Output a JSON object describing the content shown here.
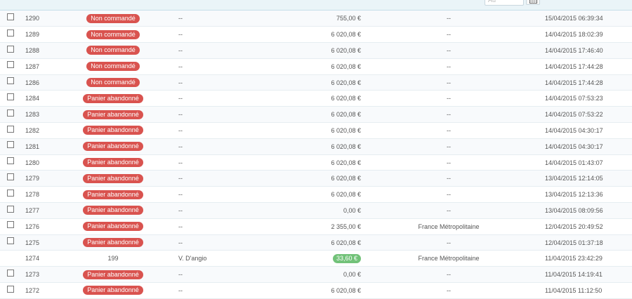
{
  "filter": {
    "to_placeholder": "Au"
  },
  "rows": [
    {
      "id": "1290",
      "status": "Non commandé",
      "status_type": "badge",
      "customer": "--",
      "total": "755,00 €",
      "total_type": "plain",
      "carrier": "--",
      "date": "15/04/2015 06:39:34",
      "checkbox": true
    },
    {
      "id": "1289",
      "status": "Non commandé",
      "status_type": "badge",
      "customer": "--",
      "total": "6 020,08 €",
      "total_type": "plain",
      "carrier": "--",
      "date": "14/04/2015 18:02:39",
      "checkbox": true
    },
    {
      "id": "1288",
      "status": "Non commandé",
      "status_type": "badge",
      "customer": "--",
      "total": "6 020,08 €",
      "total_type": "plain",
      "carrier": "--",
      "date": "14/04/2015 17:46:40",
      "checkbox": true
    },
    {
      "id": "1287",
      "status": "Non commandé",
      "status_type": "badge",
      "customer": "--",
      "total": "6 020,08 €",
      "total_type": "plain",
      "carrier": "--",
      "date": "14/04/2015 17:44:28",
      "checkbox": true
    },
    {
      "id": "1286",
      "status": "Non commandé",
      "status_type": "badge",
      "customer": "--",
      "total": "6 020,08 €",
      "total_type": "plain",
      "carrier": "--",
      "date": "14/04/2015 17:44:28",
      "checkbox": true
    },
    {
      "id": "1284",
      "status": "Panier abandonné",
      "status_type": "badge",
      "customer": "--",
      "total": "6 020,08 €",
      "total_type": "plain",
      "carrier": "--",
      "date": "14/04/2015 07:53:23",
      "checkbox": true
    },
    {
      "id": "1283",
      "status": "Panier abandonné",
      "status_type": "badge",
      "customer": "--",
      "total": "6 020,08 €",
      "total_type": "plain",
      "carrier": "--",
      "date": "14/04/2015 07:53:22",
      "checkbox": true
    },
    {
      "id": "1282",
      "status": "Panier abandonné",
      "status_type": "badge",
      "customer": "--",
      "total": "6 020,08 €",
      "total_type": "plain",
      "carrier": "--",
      "date": "14/04/2015 04:30:17",
      "checkbox": true
    },
    {
      "id": "1281",
      "status": "Panier abandonné",
      "status_type": "badge",
      "customer": "--",
      "total": "6 020,08 €",
      "total_type": "plain",
      "carrier": "--",
      "date": "14/04/2015 04:30:17",
      "checkbox": true
    },
    {
      "id": "1280",
      "status": "Panier abandonné",
      "status_type": "badge",
      "customer": "--",
      "total": "6 020,08 €",
      "total_type": "plain",
      "carrier": "--",
      "date": "14/04/2015 01:43:07",
      "checkbox": true
    },
    {
      "id": "1279",
      "status": "Panier abandonné",
      "status_type": "badge",
      "customer": "--",
      "total": "6 020,08 €",
      "total_type": "plain",
      "carrier": "--",
      "date": "13/04/2015 12:14:05",
      "checkbox": true
    },
    {
      "id": "1278",
      "status": "Panier abandonné",
      "status_type": "badge",
      "customer": "--",
      "total": "6 020,08 €",
      "total_type": "plain",
      "carrier": "--",
      "date": "13/04/2015 12:13:36",
      "checkbox": true
    },
    {
      "id": "1277",
      "status": "Panier abandonné",
      "status_type": "badge",
      "customer": "--",
      "total": "0,00 €",
      "total_type": "plain",
      "carrier": "--",
      "date": "13/04/2015 08:09:56",
      "checkbox": true
    },
    {
      "id": "1276",
      "status": "Panier abandonné",
      "status_type": "badge",
      "customer": "--",
      "total": "2 355,00 €",
      "total_type": "plain",
      "carrier": "France Métropolitaine",
      "date": "12/04/2015 20:49:52",
      "checkbox": true
    },
    {
      "id": "1275",
      "status": "Panier abandonné",
      "status_type": "badge",
      "customer": "--",
      "total": "6 020,08 €",
      "total_type": "plain",
      "carrier": "--",
      "date": "12/04/2015 01:37:18",
      "checkbox": true
    },
    {
      "id": "1274",
      "status": "199",
      "status_type": "plain",
      "customer": "V. D'angio",
      "total": "33,60 €",
      "total_type": "green",
      "carrier": "France Métropolitaine",
      "date": "11/04/2015 23:42:29",
      "checkbox": false
    },
    {
      "id": "1273",
      "status": "Panier abandonné",
      "status_type": "badge",
      "customer": "--",
      "total": "0,00 €",
      "total_type": "plain",
      "carrier": "--",
      "date": "11/04/2015 14:19:41",
      "checkbox": true
    },
    {
      "id": "1272",
      "status": "Panier abandonné",
      "status_type": "badge",
      "customer": "--",
      "total": "6 020,08 €",
      "total_type": "plain",
      "carrier": "--",
      "date": "11/04/2015 11:12:50",
      "checkbox": true
    }
  ]
}
